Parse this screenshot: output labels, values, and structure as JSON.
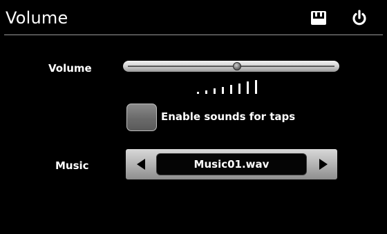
{
  "header": {
    "title": "Volume",
    "save_icon": "save-icon",
    "power_icon": "power-icon"
  },
  "volume": {
    "label": "Volume",
    "level": 0.53,
    "level_bars": 8
  },
  "tap_sounds": {
    "label": "Enable sounds for taps",
    "checked": false
  },
  "music": {
    "label": "Music",
    "selected": "Music01.wav",
    "prev_icon": "triangle-left-icon",
    "next_icon": "triangle-right-icon"
  },
  "colors": {
    "background": "#000000",
    "text": "#ffffff",
    "control_gray": "#b4b4b4"
  }
}
